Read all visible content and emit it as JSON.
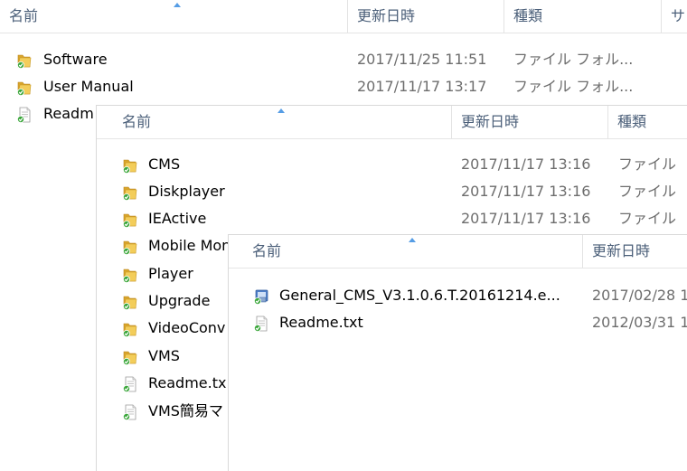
{
  "pane1": {
    "headers": {
      "name": "名前",
      "modified": "更新日時",
      "type": "種類",
      "size": "サ"
    },
    "rows": [
      {
        "name": "Software",
        "modified": "2017/11/25 11:51",
        "type": "ファイル フォル...",
        "icon": "folder-icon"
      },
      {
        "name": "User Manual",
        "modified": "2017/11/17 13:17",
        "type": "ファイル フォル...",
        "icon": "folder-icon"
      },
      {
        "name": "Readm",
        "modified": "",
        "type": "",
        "icon": "text-file-icon"
      }
    ]
  },
  "pane2": {
    "headers": {
      "name": "名前",
      "modified": "更新日時",
      "type": "種類"
    },
    "rows": [
      {
        "name": "CMS",
        "modified": "2017/11/17 13:16",
        "type": "ファイル",
        "icon": "folder-icon"
      },
      {
        "name": "Diskplayer",
        "modified": "2017/11/17 13:16",
        "type": "ファイル",
        "icon": "folder-icon"
      },
      {
        "name": "IEActive",
        "modified": "2017/11/17 13:16",
        "type": "ファイル",
        "icon": "folder-icon"
      },
      {
        "name": "Mobile Mon",
        "modified": "",
        "type": "",
        "icon": "folder-icon"
      },
      {
        "name": "Player",
        "modified": "",
        "type": "",
        "icon": "folder-icon"
      },
      {
        "name": "Upgrade",
        "modified": "",
        "type": "",
        "icon": "folder-icon"
      },
      {
        "name": "VideoConv",
        "modified": "",
        "type": "",
        "icon": "folder-icon"
      },
      {
        "name": "VMS",
        "modified": "",
        "type": "",
        "icon": "folder-icon"
      },
      {
        "name": "Readme.tx",
        "modified": "",
        "type": "",
        "icon": "text-file-icon"
      },
      {
        "name": "VMS簡易マ",
        "modified": "",
        "type": "",
        "icon": "text-file-icon"
      }
    ]
  },
  "pane3": {
    "headers": {
      "name": "名前",
      "modified": "更新日時"
    },
    "rows": [
      {
        "name": "General_CMS_V3.1.0.6.T.20161214.e...",
        "modified": "2017/02/28 1",
        "icon": "installer-icon"
      },
      {
        "name": "Readme.txt",
        "modified": "2012/03/31 1",
        "icon": "text-file-icon"
      }
    ]
  },
  "colors": {
    "header_text": "#4c607a",
    "sort_arrow": "#569de5",
    "folder_yellow": "#e8b53a",
    "check_green": "#3aa63a"
  }
}
